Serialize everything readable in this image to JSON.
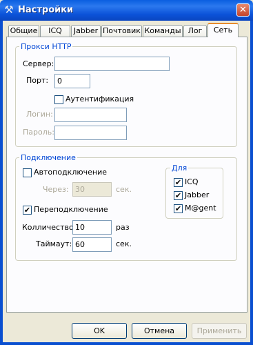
{
  "window": {
    "title": "Настройки",
    "close_symbol": "✕",
    "app_icon": "tools-icon"
  },
  "tabs": [
    "Общие",
    "ICQ",
    "Jabber",
    "Почтовик",
    "Команды",
    "Лог",
    "Сеть"
  ],
  "active_tab": "Сеть",
  "proxy": {
    "legend": "Прокси HTTP",
    "server_label": "Сервер:",
    "server_value": "",
    "port_label": "Порт:",
    "port_value": "0",
    "auth_label": "Аутентификация",
    "auth_checked": false,
    "login_label": "Логин:",
    "login_value": "",
    "password_label": "Пароль:",
    "password_value": ""
  },
  "connection": {
    "legend": "Подключение",
    "autoconnect_label": "Автоподключение",
    "autoconnect_checked": false,
    "every_label": "Через:",
    "every_value": "30",
    "every_unit": "сек.",
    "reconnect_label": "Переподключение",
    "reconnect_checked": true,
    "count_label": "Колличество:",
    "count_value": "10",
    "count_unit": "раз",
    "timeout_label": "Таймаут:",
    "timeout_value": "60",
    "timeout_unit": "сек.",
    "for_group": {
      "legend": "Для",
      "items": [
        {
          "label": "ICQ",
          "checked": true
        },
        {
          "label": "Jabber",
          "checked": true
        },
        {
          "label": "M@gent",
          "checked": true
        }
      ]
    }
  },
  "buttons": {
    "ok": "OK",
    "cancel": "Отмена",
    "apply": "Применить"
  },
  "check_mark": "✔"
}
